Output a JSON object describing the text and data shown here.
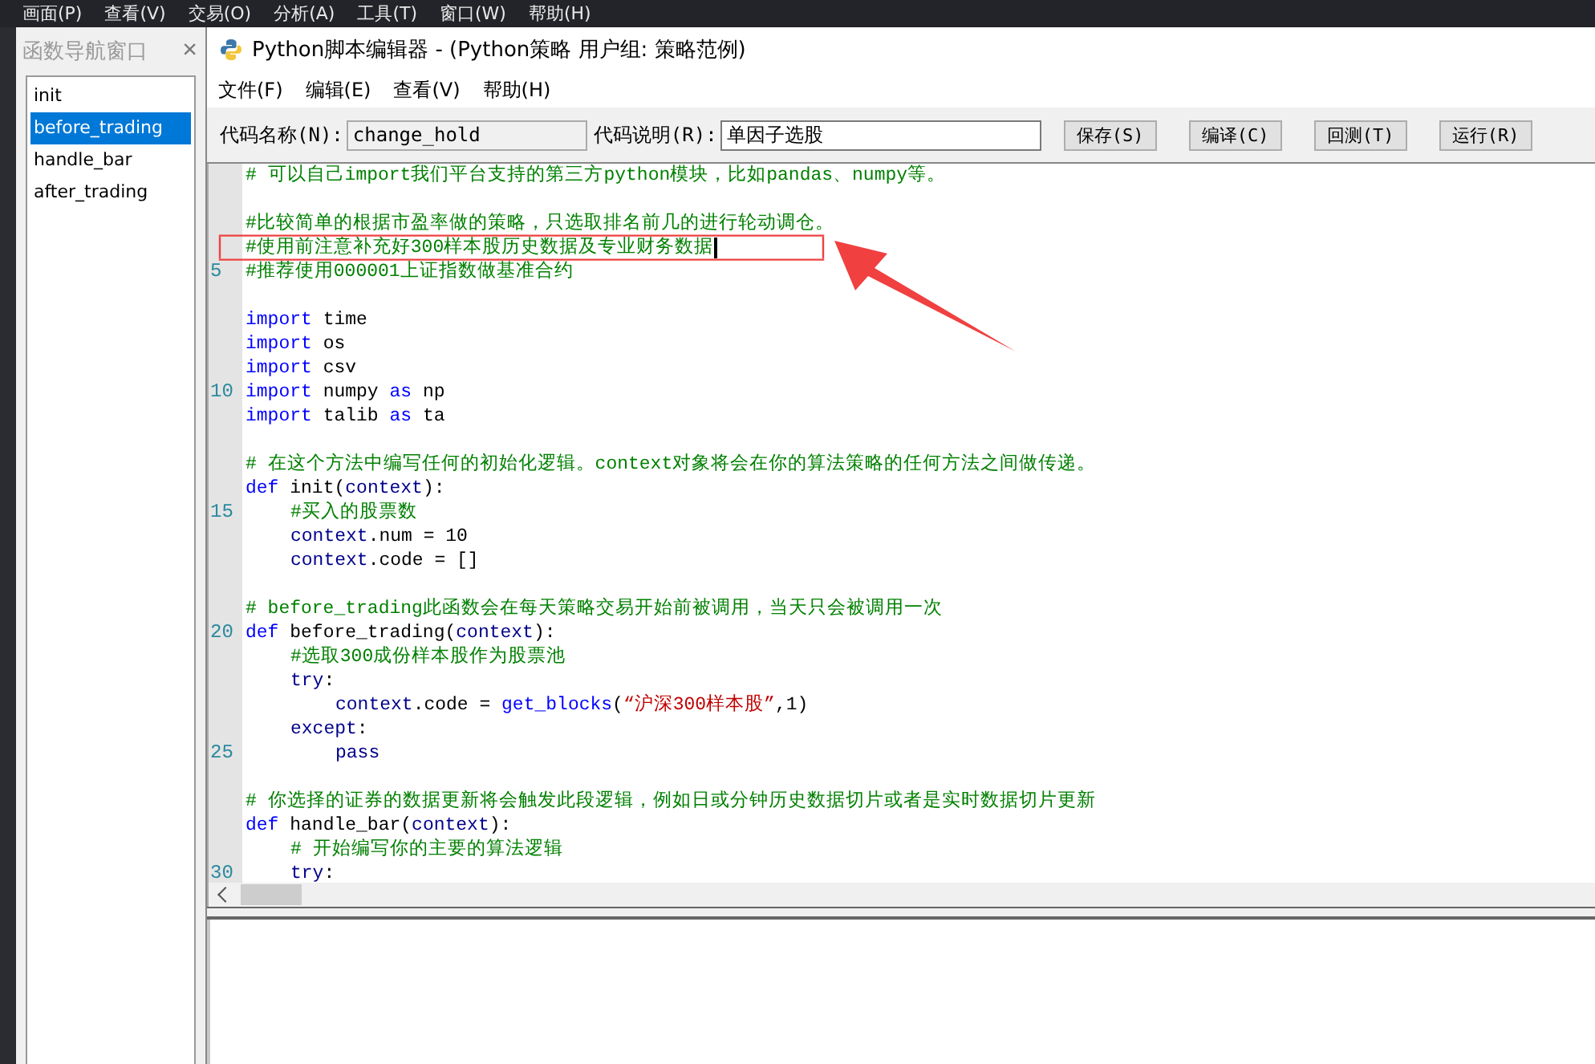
{
  "app_menu": [
    "画面(P)",
    "查看(V)",
    "交易(O)",
    "分析(A)",
    "工具(T)",
    "窗口(W)",
    "帮助(H)"
  ],
  "navigator": {
    "title": "函数导航窗口",
    "close": "×",
    "items": [
      {
        "label": "init",
        "selected": false
      },
      {
        "label": "before_trading",
        "selected": true
      },
      {
        "label": "handle_bar",
        "selected": false
      },
      {
        "label": "after_trading",
        "selected": false
      }
    ]
  },
  "editor": {
    "title": "Python脚本编辑器 - (Python策略 用户组: 策略范例)",
    "menu": [
      "文件(F)",
      "编辑(E)",
      "查看(V)",
      "帮助(H)"
    ],
    "name_label": "代码名称(N):",
    "name_value": "change_hold",
    "desc_label": "代码说明(R):",
    "desc_value": "单因子选股",
    "buttons": [
      "保存(S)",
      "编译(C)",
      "回测(T)",
      "运行(R)"
    ],
    "lines": [
      {
        "kind": "code",
        "tokens": [
          {
            "kind": "comment",
            "text": "# 可以自己import我们平台支持的第三方python模块，比如pandas、numpy等。"
          }
        ]
      },
      {
        "kind": "blank"
      },
      {
        "kind": "code",
        "tokens": [
          {
            "kind": "comment",
            "text": "#比较简单的根据市盈率做的策略，只选取排名前几的进行轮动调仓。"
          }
        ]
      },
      {
        "kind": "code",
        "tokens": [
          {
            "kind": "comment",
            "text": "#使用前注意补充好300样本股历史数据及专业财务数据"
          }
        ],
        "cursor": true
      },
      {
        "kind": "code",
        "number": "5",
        "tokens": [
          {
            "kind": "comment",
            "text": "#推荐使用000001上证指数做基准合约"
          }
        ]
      },
      {
        "kind": "blank"
      },
      {
        "kind": "code",
        "tokens": [
          {
            "kind": "keyword",
            "text": "import"
          },
          {
            "kind": "plain",
            "text": " time"
          }
        ]
      },
      {
        "kind": "code",
        "tokens": [
          {
            "kind": "keyword",
            "text": "import"
          },
          {
            "kind": "plain",
            "text": " os"
          }
        ]
      },
      {
        "kind": "code",
        "tokens": [
          {
            "kind": "keyword",
            "text": "import"
          },
          {
            "kind": "plain",
            "text": " csv"
          }
        ]
      },
      {
        "kind": "code",
        "number": "10",
        "tokens": [
          {
            "kind": "keyword",
            "text": "import"
          },
          {
            "kind": "plain",
            "text": " numpy "
          },
          {
            "kind": "keyword",
            "text": "as"
          },
          {
            "kind": "plain",
            "text": " np"
          }
        ]
      },
      {
        "kind": "code",
        "tokens": [
          {
            "kind": "keyword",
            "text": "import"
          },
          {
            "kind": "plain",
            "text": " talib "
          },
          {
            "kind": "keyword",
            "text": "as"
          },
          {
            "kind": "plain",
            "text": " ta"
          }
        ]
      },
      {
        "kind": "blank"
      },
      {
        "kind": "code",
        "tokens": [
          {
            "kind": "comment",
            "text": "# 在这个方法中编写任何的初始化逻辑。context对象将会在你的算法策略的任何方法之间做传递。"
          }
        ]
      },
      {
        "kind": "code",
        "tokens": [
          {
            "kind": "keyword",
            "text": "def"
          },
          {
            "kind": "plain",
            "text": " init("
          },
          {
            "kind": "name",
            "text": "context"
          },
          {
            "kind": "plain",
            "text": "):"
          }
        ],
        "children": [
          {
            "kind": "code",
            "number": "15",
            "tokens": [
              {
                "kind": "comment",
                "text": "#买入的股票数"
              }
            ]
          },
          {
            "kind": "code",
            "tokens": [
              {
                "kind": "name",
                "text": "context"
              },
              {
                "kind": "plain",
                "text": ".num = 10"
              }
            ]
          },
          {
            "kind": "code",
            "tokens": [
              {
                "kind": "name",
                "text": "context"
              },
              {
                "kind": "plain",
                "text": ".code = []"
              }
            ]
          }
        ]
      },
      {
        "kind": "blank"
      },
      {
        "kind": "code",
        "tokens": [
          {
            "kind": "comment",
            "text": "# before_trading此函数会在每天策略交易开始前被调用，当天只会被调用一次"
          }
        ]
      },
      {
        "kind": "code",
        "number": "20",
        "tokens": [
          {
            "kind": "keyword",
            "text": "def"
          },
          {
            "kind": "plain",
            "text": " before_trading("
          },
          {
            "kind": "name",
            "text": "context"
          },
          {
            "kind": "plain",
            "text": "):"
          }
        ],
        "children": [
          {
            "kind": "code",
            "tokens": [
              {
                "kind": "comment",
                "text": "#选取300成份样本股作为股票池"
              }
            ]
          },
          {
            "kind": "code",
            "tokens": [
              {
                "kind": "name",
                "text": "try"
              },
              {
                "kind": "plain",
                "text": ":"
              }
            ],
            "children": [
              {
                "kind": "code",
                "tokens": [
                  {
                    "kind": "name",
                    "text": "context"
                  },
                  {
                    "kind": "plain",
                    "text": ".code = "
                  },
                  {
                    "kind": "keyword",
                    "text": "get_blocks"
                  },
                  {
                    "kind": "plain",
                    "text": "("
                  },
                  {
                    "kind": "string",
                    "text": "“沪深300样本股”"
                  },
                  {
                    "kind": "plain",
                    "text": ",1)"
                  }
                ]
              }
            ]
          },
          {
            "kind": "code",
            "tokens": [
              {
                "kind": "name",
                "text": "except"
              },
              {
                "kind": "plain",
                "text": ":"
              }
            ],
            "children": [
              {
                "kind": "code",
                "number": "25",
                "tokens": [
                  {
                    "kind": "name",
                    "text": "pass"
                  }
                ]
              }
            ]
          }
        ]
      },
      {
        "kind": "blank"
      },
      {
        "kind": "code",
        "tokens": [
          {
            "kind": "comment",
            "text": "# 你选择的证券的数据更新将会触发此段逻辑，例如日或分钟历史数据切片或者是实时数据切片更新"
          }
        ]
      },
      {
        "kind": "code",
        "tokens": [
          {
            "kind": "keyword",
            "text": "def"
          },
          {
            "kind": "plain",
            "text": " handle_bar("
          },
          {
            "kind": "name",
            "text": "context"
          },
          {
            "kind": "plain",
            "text": "):"
          }
        ],
        "children": [
          {
            "kind": "code",
            "tokens": [
              {
                "kind": "comment",
                "text": "# 开始编写你的主要的算法逻辑"
              }
            ]
          },
          {
            "kind": "code",
            "number": "30",
            "tokens": [
              {
                "kind": "name",
                "text": "try"
              },
              {
                "kind": "plain",
                "text": ":"
              }
            ]
          }
        ]
      }
    ]
  }
}
